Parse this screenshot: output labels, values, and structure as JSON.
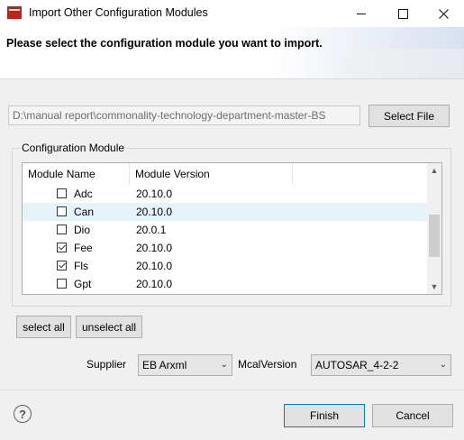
{
  "window": {
    "title": "Import Other Configuration Modules",
    "minimize_icon": "minimize-icon",
    "maximize_icon": "maximize-icon",
    "close_icon": "close-icon"
  },
  "banner": {
    "title": "Please select the configuration module you want to import."
  },
  "path": {
    "value": "D:\\manual report\\commonality-technology-department-master-BS",
    "button_label": "Select File"
  },
  "group": {
    "legend": "Configuration Module",
    "columns": [
      "Module Name",
      "Module Version"
    ],
    "rows": [
      {
        "name": "Adc",
        "version": "20.10.0",
        "checked": false
      },
      {
        "name": "Can",
        "version": "20.10.0",
        "checked": false
      },
      {
        "name": "Dio",
        "version": "20.0.1",
        "checked": false
      },
      {
        "name": "Fee",
        "version": "20.10.0",
        "checked": true
      },
      {
        "name": "Fls",
        "version": "20.10.0",
        "checked": true
      },
      {
        "name": "Gpt",
        "version": "20.10.0",
        "checked": false
      }
    ]
  },
  "selection": {
    "select_all": "select all",
    "unselect_all": "unselect all"
  },
  "options": {
    "supplier_label": "Supplier",
    "supplier_value": "EB Arxml",
    "mcal_label": "McalVersion",
    "mcal_value": "AUTOSAR_4-2-2"
  },
  "footer": {
    "help_icon": "help-icon",
    "finish": "Finish",
    "cancel": "Cancel"
  },
  "colors": {
    "app_icon": "#c0231c",
    "row_highlight": "#e5f3fb",
    "default_button_border": "#0078d7"
  }
}
